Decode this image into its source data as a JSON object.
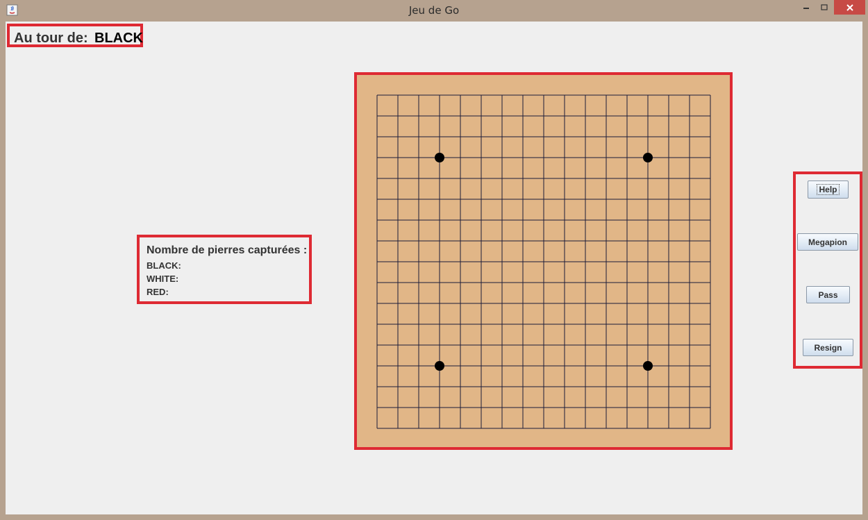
{
  "window": {
    "title": "Jeu de Go",
    "icons": [
      "java-app-icon",
      "minimize-icon",
      "maximize-icon",
      "close-icon"
    ]
  },
  "turn": {
    "label": "Au tour de:",
    "player": "BLACK"
  },
  "captures": {
    "title": "Nombre de pierres capturées :",
    "rows": [
      {
        "label": "BLACK:"
      },
      {
        "label": "WHITE:"
      },
      {
        "label": "RED:"
      }
    ]
  },
  "board": {
    "grid_cells": 16,
    "board_color": "#e1b687",
    "line_color": "#1c1c3a",
    "star_points": [
      [
        3,
        3
      ],
      [
        13,
        3
      ],
      [
        3,
        13
      ],
      [
        13,
        13
      ]
    ]
  },
  "buttons": {
    "help": "Help",
    "megapion": "Megapion",
    "pass": "Pass",
    "resign": "Resign"
  },
  "colors": {
    "highlight_border": "#de2a33",
    "close_button": "#c74a45"
  }
}
